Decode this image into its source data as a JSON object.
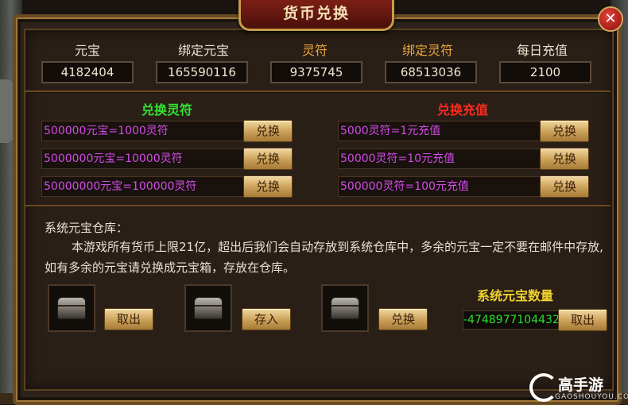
{
  "window": {
    "title": "货币兑换",
    "close_label": "✕"
  },
  "stats": [
    {
      "label": "元宝",
      "value": "4182404",
      "color": "#e9e2d0"
    },
    {
      "label": "绑定元宝",
      "value": "165590116",
      "color": "#e9e2d0"
    },
    {
      "label": "灵符",
      "value": "9375745",
      "color": "#e8a63a"
    },
    {
      "label": "绑定灵符",
      "value": "68513036",
      "color": "#e8a63a"
    },
    {
      "label": "每日充值",
      "value": "2100",
      "color": "#e9e2d0"
    }
  ],
  "exchange_lingfu": {
    "title": "兑换灵符",
    "title_color": "#35e035",
    "rows": [
      {
        "text": "500000元宝=1000灵符",
        "button": "兑换"
      },
      {
        "text": "5000000元宝=10000灵符",
        "button": "兑换"
      },
      {
        "text": "50000000元宝=100000灵符",
        "button": "兑换"
      }
    ]
  },
  "exchange_recharge": {
    "title": "兑换充值",
    "title_color": "#ff2a1e",
    "rows": [
      {
        "text": "5000灵符=1元充值",
        "button": "兑换"
      },
      {
        "text": "50000灵符=10元充值",
        "button": "兑换"
      },
      {
        "text": "500000灵符=100元充值",
        "button": "兑换"
      }
    ]
  },
  "warehouse": {
    "title": "系统元宝仓库：",
    "notice": "本游戏所有货币上限21亿，超出后我们会自动存放到系统仓库中，多余的元宝一定不要在邮件中存放,如有多余的元宝请兑换成元宝箱，存放在仓库。",
    "slots": [
      {
        "icon": "treasure-chest-icon",
        "button": "取出"
      },
      {
        "icon": "treasure-chest-icon",
        "button": "存入"
      },
      {
        "icon": "treasure-chest-icon",
        "button": "兑换"
      }
    ],
    "count_label": "系统元宝数量",
    "count_value": "-4748977104432",
    "count_button": "取出"
  },
  "watermark": {
    "brand": "高手游",
    "domain": "GAOSHOUYOU.COM"
  }
}
